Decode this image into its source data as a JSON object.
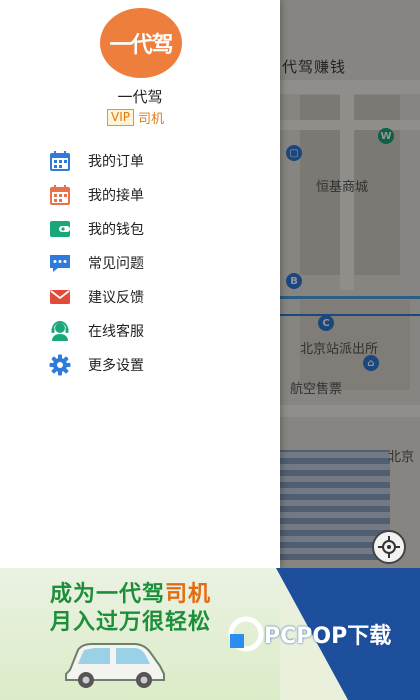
{
  "background": {
    "title": "代驾赚钱",
    "map_labels": [
      "恒基商城",
      "北京站派出所",
      "航空售票",
      "北京"
    ]
  },
  "drawer": {
    "logo_text": "一代驾",
    "user_name": "一代驾",
    "vip_badge": "VIP",
    "role": "司机",
    "menu": [
      {
        "label": "我的订单",
        "icon": "calendar-icon",
        "color": "#2f7bd9"
      },
      {
        "label": "我的接单",
        "icon": "calendar-icon",
        "color": "#e8704a"
      },
      {
        "label": "我的钱包",
        "icon": "wallet-icon",
        "color": "#19a67a"
      },
      {
        "label": "常见问题",
        "icon": "chat-icon",
        "color": "#2f7bd9"
      },
      {
        "label": "建议反馈",
        "icon": "mail-icon",
        "color": "#e14b38"
      },
      {
        "label": "在线客服",
        "icon": "headset-icon",
        "color": "#19a67a"
      },
      {
        "label": "更多设置",
        "icon": "gear-icon",
        "color": "#2f7bd9"
      }
    ]
  },
  "banner": {
    "line1_a": "成为一代驾",
    "line1_b": "司机",
    "line2": "月入过万很轻松",
    "watermark": "PCPOP下载"
  },
  "colors": {
    "accent": "#ee7e3c",
    "brand_green": "#1d8f3a",
    "watermark_blue": "#1e4f9c"
  }
}
